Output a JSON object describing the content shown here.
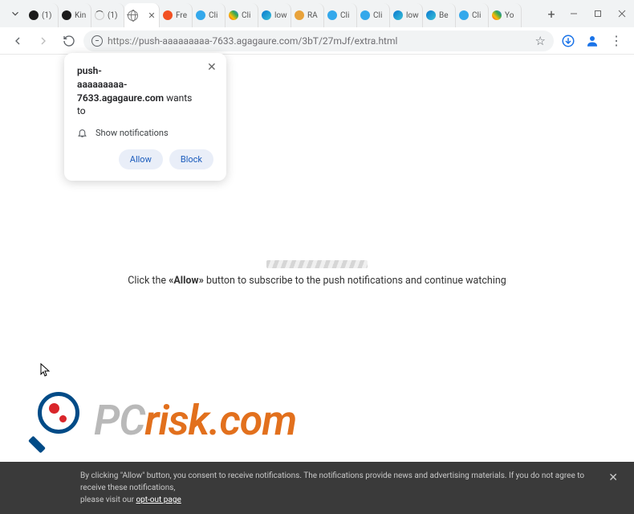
{
  "tabs": [
    {
      "label": "(1)",
      "icon": "circle-dark"
    },
    {
      "label": "Kin",
      "icon": "circle-dark"
    },
    {
      "label": "(1)",
      "icon": "spinner"
    },
    {
      "label": "",
      "icon": "globe",
      "active": true
    },
    {
      "label": "Fre",
      "icon": "brave"
    },
    {
      "label": "Cli",
      "icon": "cloud"
    },
    {
      "label": "Cli",
      "icon": "chrome"
    },
    {
      "label": "low",
      "icon": "edge"
    },
    {
      "label": "RA",
      "icon": "amber"
    },
    {
      "label": "Cli",
      "icon": "cloud"
    },
    {
      "label": "Cli",
      "icon": "cloud"
    },
    {
      "label": "low",
      "icon": "edge"
    },
    {
      "label": "Be",
      "icon": "edge"
    },
    {
      "label": "Cli",
      "icon": "cloud"
    },
    {
      "label": "Yo",
      "icon": "chrome"
    }
  ],
  "address": {
    "scheme": "https://",
    "rest": "push-aaaaaaaaa-7633.agagaure.com/3bT/27mJf/extra.html"
  },
  "permission": {
    "origin_line1": "push-",
    "origin_line2": "aaaaaaaaa-7633.agagaure.com",
    "wants_to": "wants to",
    "capability": "Show notifications",
    "allow": "Allow",
    "block": "Block"
  },
  "page": {
    "prefix": "Click the ",
    "emph": "«Allow»",
    "suffix": " button to subscribe to the push notifications and continue watching"
  },
  "brand": {
    "part1": "PC",
    "part2": "risk.com"
  },
  "cookie": {
    "text1": "By clicking \"Allow\" button, you consent to receive notifications. The notifications provide news and advertising materials. If you do not agree to receive these notifications,",
    "text2": "please visit our ",
    "link": "opt-out page"
  }
}
